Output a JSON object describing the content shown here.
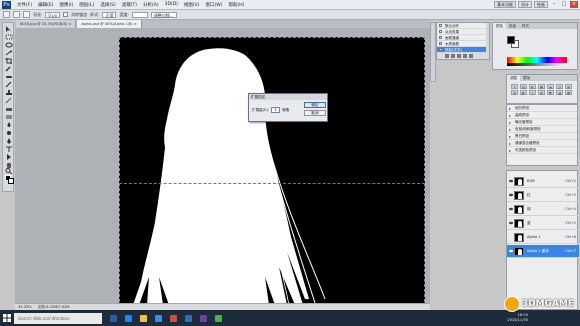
{
  "app": {
    "logo_text": "Ps"
  },
  "menu": [
    "文件(F)",
    "编辑(E)",
    "图像(I)",
    "图层(L)",
    "选择(S)",
    "滤镜(T)",
    "分析(A)",
    "3D(D)",
    "视图(V)",
    "窗口(W)",
    "帮助(H)"
  ],
  "workspace": [
    "基本功能",
    "设计",
    "绘画"
  ],
  "options": {
    "feather_label": "羽化:",
    "feather_value": "0 px",
    "antialias_label": "消除锯齿",
    "style_label": "样式:",
    "style_value": "正常",
    "width_label": "宽度:",
    "refine_label": "调整边缘..."
  },
  "tabs": [
    {
      "label": "8018.jpg @ 33.3%(RGB/8) ×"
    },
    {
      "label": "alpha.psd @ 40%(Alpha 1/8) ×"
    }
  ],
  "dialog": {
    "title": "扩展选区",
    "field_label": "扩展量(E):",
    "field_value": "5",
    "unit": "像素",
    "ok": "确定",
    "cancel": "取消"
  },
  "actions": {
    "items": [
      "默认动作",
      "淡出效果",
      "画框通道",
      "木质画框",
      "投影(文字)"
    ],
    "selected_index": 4
  },
  "color_panel": {
    "tabs": [
      "颜色",
      "色板",
      "样式"
    ],
    "fg": "#000000",
    "bg": "#ffffff"
  },
  "adjustments": {
    "tabs": [
      "调整",
      "蒙版"
    ],
    "icons": [
      "☀",
      "▥",
      "◐",
      "▦",
      "◒",
      "◔",
      "▤",
      "▧",
      "◧",
      "◫",
      "▨",
      "◩",
      "◪",
      "▩"
    ]
  },
  "presets": {
    "items": [
      "色阶预设",
      "曲线预设",
      "曝光度预设",
      "色相/饱和度预设",
      "黑白预设",
      "通道混合器预设",
      "可选颜色预设"
    ]
  },
  "layers": {
    "rows": [
      {
        "name": "RGB",
        "shortcut": "Ctrl+2"
      },
      {
        "name": "红",
        "shortcut": "Ctrl+3"
      },
      {
        "name": "绿",
        "shortcut": "Ctrl+4"
      },
      {
        "name": "蓝",
        "shortcut": "Ctrl+5"
      },
      {
        "name": "Alpha 1",
        "shortcut": "Ctrl+6"
      },
      {
        "name": "Alpha 1 副本",
        "shortcut": "Ctrl+7"
      }
    ],
    "selected_index": 5
  },
  "status": {
    "zoom": "33.33%",
    "doc": "文档:3.02M/7.02M"
  },
  "taskbar": {
    "search_placeholder": "Search Web and Windows",
    "time": "18:55",
    "date": "2015/11/30"
  },
  "watermark": {
    "text": "3DMGAME"
  }
}
